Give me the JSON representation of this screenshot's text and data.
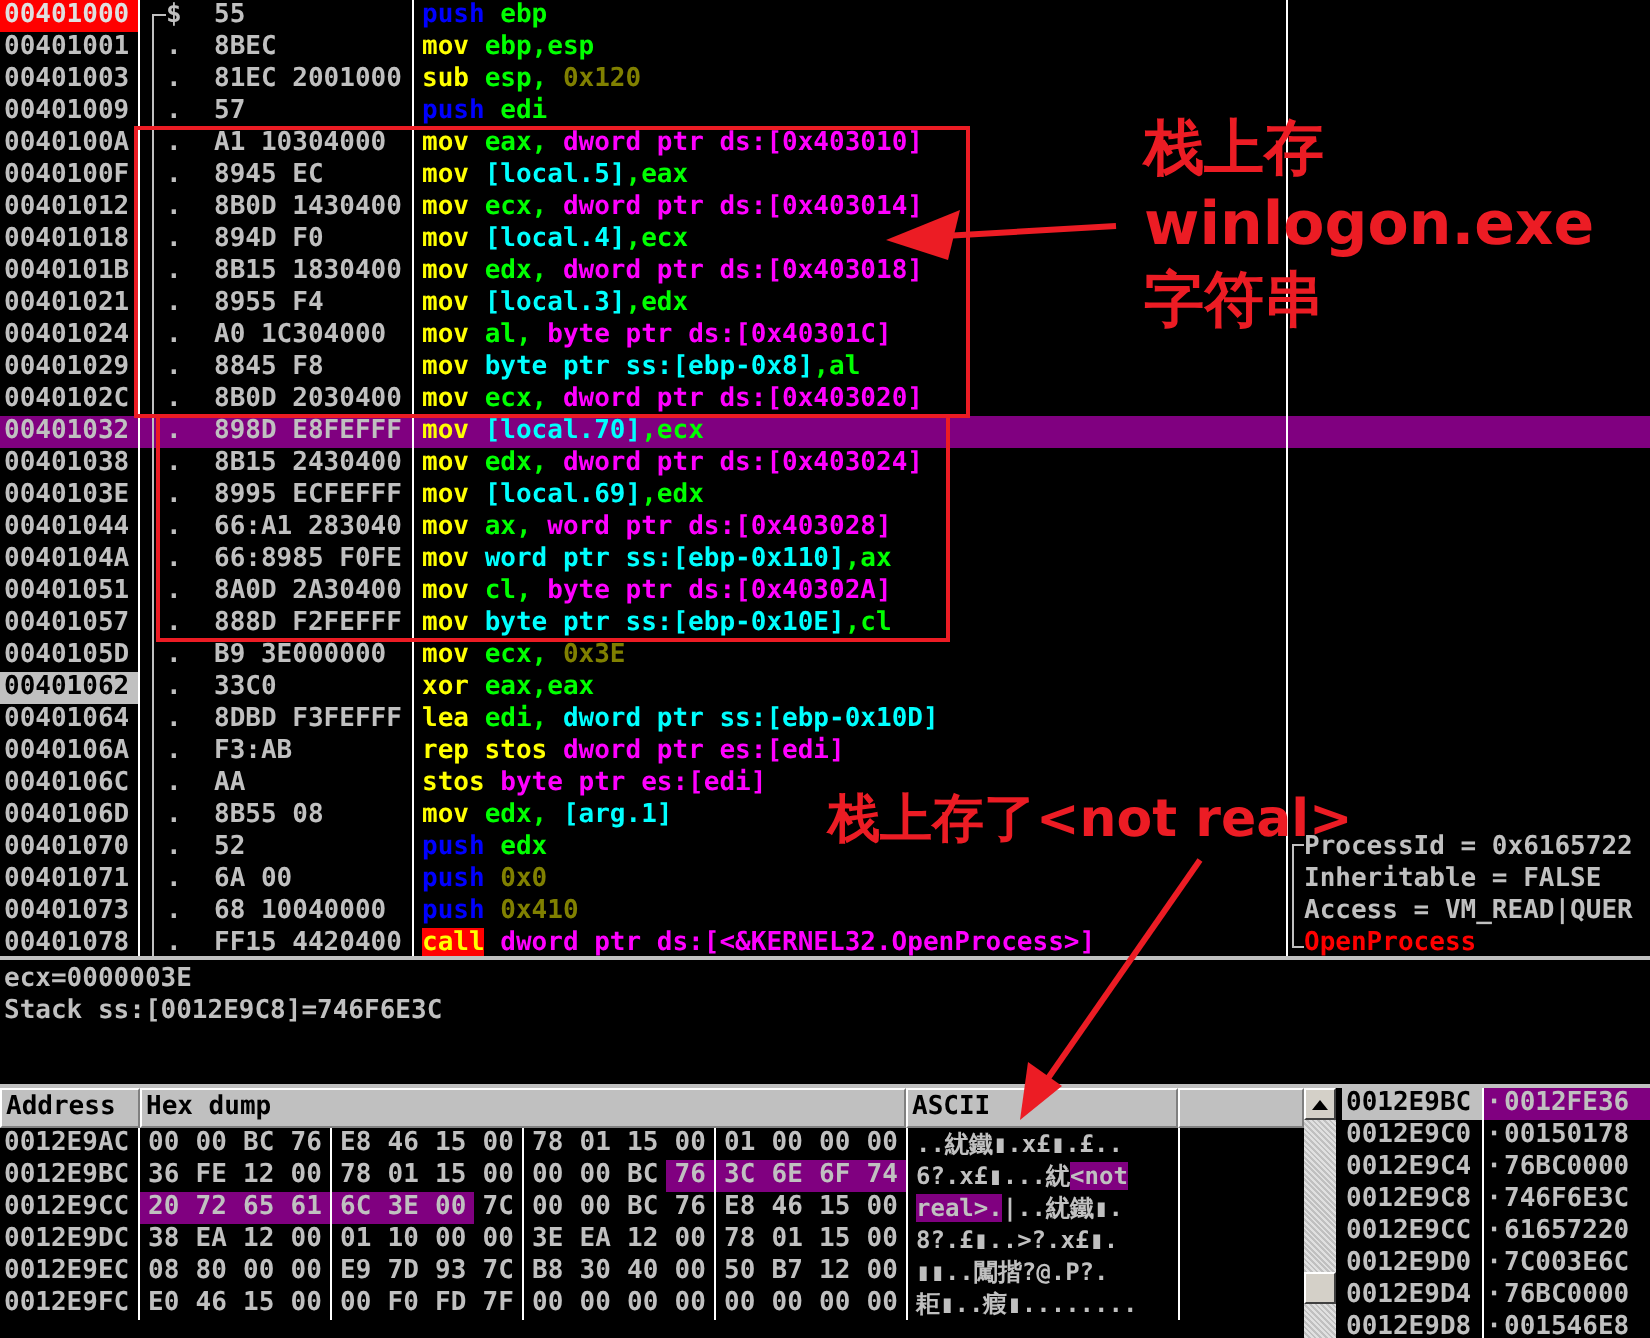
{
  "disassembly": {
    "rows": [
      {
        "address": "00401000",
        "breakpoint": true,
        "marked": false,
        "marker": "$",
        "bytes": "55",
        "selected": false,
        "instruction": [
          {
            "text": "push",
            "kind": "push"
          },
          {
            "text": "ebp",
            "kind": "reg"
          }
        ]
      },
      {
        "address": "00401001",
        "breakpoint": false,
        "marked": false,
        "marker": ".",
        "bytes": "8BEC",
        "selected": false,
        "instruction": [
          {
            "text": "mov",
            "kind": "op"
          },
          {
            "text": "ebp,esp",
            "kind": "reg"
          }
        ]
      },
      {
        "address": "00401003",
        "breakpoint": false,
        "marked": false,
        "marker": ".",
        "bytes": "81EC 2001000",
        "selected": false,
        "instruction": [
          {
            "text": "sub",
            "kind": "op"
          },
          {
            "text": "esp,",
            "kind": "reg"
          },
          {
            "text": "0x120",
            "kind": "num"
          }
        ]
      },
      {
        "address": "00401009",
        "breakpoint": false,
        "marked": false,
        "marker": ".",
        "bytes": "57",
        "selected": false,
        "instruction": [
          {
            "text": "push",
            "kind": "push"
          },
          {
            "text": "edi",
            "kind": "reg"
          }
        ]
      },
      {
        "address": "0040100A",
        "breakpoint": false,
        "marked": false,
        "marker": ".",
        "bytes": "A1 10304000",
        "selected": false,
        "instruction": [
          {
            "text": "mov",
            "kind": "op"
          },
          {
            "text": "eax,",
            "kind": "reg"
          },
          {
            "text": "dword ptr ds:[0x403010]",
            "kind": "mem"
          }
        ]
      },
      {
        "address": "0040100F",
        "breakpoint": false,
        "marked": false,
        "marker": ".",
        "bytes": "8945 EC",
        "selected": false,
        "instruction": [
          {
            "text": "mov",
            "kind": "op"
          },
          {
            "text": "[local.5]",
            "kind": "stack"
          },
          {
            "text": ",eax",
            "kind": "reg"
          }
        ]
      },
      {
        "address": "00401012",
        "breakpoint": false,
        "marked": false,
        "marker": ".",
        "bytes": "8B0D 1430400",
        "selected": false,
        "instruction": [
          {
            "text": "mov",
            "kind": "op"
          },
          {
            "text": "ecx,",
            "kind": "reg"
          },
          {
            "text": "dword ptr ds:[0x403014]",
            "kind": "mem"
          }
        ]
      },
      {
        "address": "00401018",
        "breakpoint": false,
        "marked": false,
        "marker": ".",
        "bytes": "894D F0",
        "selected": false,
        "instruction": [
          {
            "text": "mov",
            "kind": "op"
          },
          {
            "text": "[local.4]",
            "kind": "stack"
          },
          {
            "text": ",ecx",
            "kind": "reg"
          }
        ]
      },
      {
        "address": "0040101B",
        "breakpoint": false,
        "marked": false,
        "marker": ".",
        "bytes": "8B15 1830400",
        "selected": false,
        "instruction": [
          {
            "text": "mov",
            "kind": "op"
          },
          {
            "text": "edx,",
            "kind": "reg"
          },
          {
            "text": "dword ptr ds:[0x403018]",
            "kind": "mem"
          }
        ]
      },
      {
        "address": "00401021",
        "breakpoint": false,
        "marked": false,
        "marker": ".",
        "bytes": "8955 F4",
        "selected": false,
        "instruction": [
          {
            "text": "mov",
            "kind": "op"
          },
          {
            "text": "[local.3]",
            "kind": "stack"
          },
          {
            "text": ",edx",
            "kind": "reg"
          }
        ]
      },
      {
        "address": "00401024",
        "breakpoint": false,
        "marked": false,
        "marker": ".",
        "bytes": "A0 1C304000",
        "selected": false,
        "instruction": [
          {
            "text": "mov",
            "kind": "op"
          },
          {
            "text": "al,",
            "kind": "reg"
          },
          {
            "text": "byte ptr ds:[0x40301C]",
            "kind": "mem"
          }
        ]
      },
      {
        "address": "00401029",
        "breakpoint": false,
        "marked": false,
        "marker": ".",
        "bytes": "8845 F8",
        "selected": false,
        "instruction": [
          {
            "text": "mov",
            "kind": "op"
          },
          {
            "text": "byte ptr ss:[ebp-0x8]",
            "kind": "stack"
          },
          {
            "text": ",al",
            "kind": "reg"
          }
        ]
      },
      {
        "address": "0040102C",
        "breakpoint": false,
        "marked": false,
        "marker": ".",
        "bytes": "8B0D 2030400",
        "selected": false,
        "instruction": [
          {
            "text": "mov",
            "kind": "op"
          },
          {
            "text": "ecx,",
            "kind": "reg"
          },
          {
            "text": "dword ptr ds:[0x403020]",
            "kind": "mem"
          }
        ]
      },
      {
        "address": "00401032",
        "breakpoint": false,
        "marked": false,
        "marker": ".",
        "bytes": "898D E8FEFFF",
        "selected": true,
        "instruction": [
          {
            "text": "mov",
            "kind": "op"
          },
          {
            "text": "[local.70]",
            "kind": "stack"
          },
          {
            "text": ",ecx",
            "kind": "reg"
          }
        ]
      },
      {
        "address": "00401038",
        "breakpoint": false,
        "marked": false,
        "marker": ".",
        "bytes": "8B15 2430400",
        "selected": false,
        "instruction": [
          {
            "text": "mov",
            "kind": "op"
          },
          {
            "text": "edx,",
            "kind": "reg"
          },
          {
            "text": "dword ptr ds:[0x403024]",
            "kind": "mem"
          }
        ]
      },
      {
        "address": "0040103E",
        "breakpoint": false,
        "marked": false,
        "marker": ".",
        "bytes": "8995 ECFEFFF",
        "selected": false,
        "instruction": [
          {
            "text": "mov",
            "kind": "op"
          },
          {
            "text": "[local.69]",
            "kind": "stack"
          },
          {
            "text": ",edx",
            "kind": "reg"
          }
        ]
      },
      {
        "address": "00401044",
        "breakpoint": false,
        "marked": false,
        "marker": ".",
        "bytes": "66:A1 283040",
        "selected": false,
        "instruction": [
          {
            "text": "mov",
            "kind": "op"
          },
          {
            "text": "ax,",
            "kind": "reg"
          },
          {
            "text": "word ptr ds:[0x403028]",
            "kind": "mem"
          }
        ]
      },
      {
        "address": "0040104A",
        "breakpoint": false,
        "marked": false,
        "marker": ".",
        "bytes": "66:8985 F0FE",
        "selected": false,
        "instruction": [
          {
            "text": "mov",
            "kind": "op"
          },
          {
            "text": "word ptr ss:[ebp-0x110]",
            "kind": "stack"
          },
          {
            "text": ",ax",
            "kind": "reg"
          }
        ]
      },
      {
        "address": "00401051",
        "breakpoint": false,
        "marked": false,
        "marker": ".",
        "bytes": "8A0D 2A30400",
        "selected": false,
        "instruction": [
          {
            "text": "mov",
            "kind": "op"
          },
          {
            "text": "cl,",
            "kind": "reg"
          },
          {
            "text": "byte ptr ds:[0x40302A]",
            "kind": "mem"
          }
        ]
      },
      {
        "address": "00401057",
        "breakpoint": false,
        "marked": false,
        "marker": ".",
        "bytes": "888D F2FEFFF",
        "selected": false,
        "instruction": [
          {
            "text": "mov",
            "kind": "op"
          },
          {
            "text": "byte ptr ss:[ebp-0x10E]",
            "kind": "stack"
          },
          {
            "text": ",cl",
            "kind": "reg"
          }
        ]
      },
      {
        "address": "0040105D",
        "breakpoint": false,
        "marked": false,
        "marker": ".",
        "bytes": "B9 3E000000",
        "selected": false,
        "instruction": [
          {
            "text": "mov",
            "kind": "op"
          },
          {
            "text": "ecx,",
            "kind": "reg"
          },
          {
            "text": "0x3E",
            "kind": "num"
          }
        ]
      },
      {
        "address": "00401062",
        "breakpoint": false,
        "marked": true,
        "marker": ".",
        "bytes": "33C0",
        "selected": false,
        "instruction": [
          {
            "text": "xor",
            "kind": "op"
          },
          {
            "text": "eax,eax",
            "kind": "reg"
          }
        ]
      },
      {
        "address": "00401064",
        "breakpoint": false,
        "marked": false,
        "marker": ".",
        "bytes": "8DBD F3FEFFF",
        "selected": false,
        "instruction": [
          {
            "text": "lea",
            "kind": "op"
          },
          {
            "text": "edi,",
            "kind": "reg"
          },
          {
            "text": "dword ptr ss:[ebp-0x10D]",
            "kind": "stack"
          }
        ]
      },
      {
        "address": "0040106A",
        "breakpoint": false,
        "marked": false,
        "marker": ".",
        "bytes": "F3:AB",
        "selected": false,
        "instruction": [
          {
            "text": "rep stos",
            "kind": "op"
          },
          {
            "text": "dword ptr es:[edi]",
            "kind": "mem"
          }
        ]
      },
      {
        "address": "0040106C",
        "breakpoint": false,
        "marked": false,
        "marker": ".",
        "bytes": "AA",
        "selected": false,
        "instruction": [
          {
            "text": "stos",
            "kind": "op"
          },
          {
            "text": "byte ptr es:[edi]",
            "kind": "mem"
          }
        ]
      },
      {
        "address": "0040106D",
        "breakpoint": false,
        "marked": false,
        "marker": ".",
        "bytes": "8B55 08",
        "selected": false,
        "instruction": [
          {
            "text": "mov",
            "kind": "op"
          },
          {
            "text": "edx,",
            "kind": "reg"
          },
          {
            "text": "[arg.1]",
            "kind": "stack"
          }
        ]
      },
      {
        "address": "00401070",
        "breakpoint": false,
        "marked": false,
        "marker": ".",
        "bytes": "52",
        "selected": false,
        "instruction": [
          {
            "text": "push",
            "kind": "push"
          },
          {
            "text": "edx",
            "kind": "reg"
          }
        ],
        "comment": {
          "text": "ProcessId = 0x6165722",
          "kind": "arg"
        }
      },
      {
        "address": "00401071",
        "breakpoint": false,
        "marked": false,
        "marker": ".",
        "bytes": "6A 00",
        "selected": false,
        "instruction": [
          {
            "text": "push",
            "kind": "push"
          },
          {
            "text": "0x0",
            "kind": "num"
          }
        ],
        "comment": {
          "text": "Inheritable = FALSE",
          "kind": "arg"
        }
      },
      {
        "address": "00401073",
        "breakpoint": false,
        "marked": false,
        "marker": ".",
        "bytes": "68 10040000",
        "selected": false,
        "instruction": [
          {
            "text": "push",
            "kind": "push"
          },
          {
            "text": "0x410",
            "kind": "num"
          }
        ],
        "comment": {
          "text": "Access = VM_READ|QUER",
          "kind": "arg"
        }
      },
      {
        "address": "00401078",
        "breakpoint": false,
        "marked": false,
        "marker": ".",
        "bytes": "FF15 4420400",
        "selected": false,
        "instruction": [
          {
            "text": "call",
            "kind": "call"
          },
          {
            "text": "dword ptr ds:[<&KERNEL32.OpenProcess>]",
            "kind": "mem"
          }
        ],
        "comment": {
          "text": "OpenProcess",
          "kind": "api"
        }
      }
    ]
  },
  "info": [
    "ecx=0000003E",
    "Stack ss:[0012E9C8]=746F6E3C"
  ],
  "dump": {
    "columns": [
      "Address",
      "Hex dump",
      "ASCII"
    ],
    "rows": [
      {
        "address": "0012E9AC",
        "bytes": [
          {
            "v": "00",
            "selected": false
          },
          {
            "v": "00",
            "selected": false
          },
          {
            "v": "BC",
            "selected": false
          },
          {
            "v": "76",
            "selected": false
          },
          {
            "v": "E8",
            "selected": false
          },
          {
            "v": "46",
            "selected": false
          },
          {
            "v": "15",
            "selected": false
          },
          {
            "v": "00",
            "selected": false
          },
          {
            "v": "78",
            "selected": false
          },
          {
            "v": "01",
            "selected": false
          },
          {
            "v": "15",
            "selected": false
          },
          {
            "v": "00",
            "selected": false
          },
          {
            "v": "01",
            "selected": false
          },
          {
            "v": "00",
            "selected": false
          },
          {
            "v": "00",
            "selected": false
          },
          {
            "v": "00",
            "selected": false
          }
        ],
        "ascii": [
          {
            "text": "..紌鐵▮.x£▮.£..",
            "selected": false
          }
        ]
      },
      {
        "address": "0012E9BC",
        "bytes": [
          {
            "v": "36",
            "selected": false
          },
          {
            "v": "FE",
            "selected": false
          },
          {
            "v": "12",
            "selected": false
          },
          {
            "v": "00",
            "selected": false
          },
          {
            "v": "78",
            "selected": false
          },
          {
            "v": "01",
            "selected": false
          },
          {
            "v": "15",
            "selected": false
          },
          {
            "v": "00",
            "selected": false
          },
          {
            "v": "00",
            "selected": false
          },
          {
            "v": "00",
            "selected": false
          },
          {
            "v": "BC",
            "selected": false
          },
          {
            "v": "76",
            "selected": true
          },
          {
            "v": "3C",
            "selected": true
          },
          {
            "v": "6E",
            "selected": true
          },
          {
            "v": "6F",
            "selected": true
          },
          {
            "v": "74",
            "selected": true
          }
        ],
        "ascii": [
          {
            "text": "6?.x£▮...紌",
            "selected": false
          },
          {
            "text": "<not",
            "selected": true
          }
        ]
      },
      {
        "address": "0012E9CC",
        "bytes": [
          {
            "v": "20",
            "selected": true
          },
          {
            "v": "72",
            "selected": true
          },
          {
            "v": "65",
            "selected": true
          },
          {
            "v": "61",
            "selected": true
          },
          {
            "v": "6C",
            "selected": true
          },
          {
            "v": "3E",
            "selected": true
          },
          {
            "v": "00",
            "selected": true
          },
          {
            "v": "7C",
            "selected": false
          },
          {
            "v": "00",
            "selected": false
          },
          {
            "v": "00",
            "selected": false
          },
          {
            "v": "BC",
            "selected": false
          },
          {
            "v": "76",
            "selected": false
          },
          {
            "v": "E8",
            "selected": false
          },
          {
            "v": "46",
            "selected": false
          },
          {
            "v": "15",
            "selected": false
          },
          {
            "v": "00",
            "selected": false
          }
        ],
        "ascii": [
          {
            "text": " real>.",
            "selected": true
          },
          {
            "text": "|..紌鐵▮.",
            "selected": false
          }
        ]
      },
      {
        "address": "0012E9DC",
        "bytes": [
          {
            "v": "38",
            "selected": false
          },
          {
            "v": "EA",
            "selected": false
          },
          {
            "v": "12",
            "selected": false
          },
          {
            "v": "00",
            "selected": false
          },
          {
            "v": "01",
            "selected": false
          },
          {
            "v": "10",
            "selected": false
          },
          {
            "v": "00",
            "selected": false
          },
          {
            "v": "00",
            "selected": false
          },
          {
            "v": "3E",
            "selected": false
          },
          {
            "v": "EA",
            "selected": false
          },
          {
            "v": "12",
            "selected": false
          },
          {
            "v": "00",
            "selected": false
          },
          {
            "v": "78",
            "selected": false
          },
          {
            "v": "01",
            "selected": false
          },
          {
            "v": "15",
            "selected": false
          },
          {
            "v": "00",
            "selected": false
          }
        ],
        "ascii": [
          {
            "text": "8?.£▮..>?.x£▮.",
            "selected": false
          }
        ]
      },
      {
        "address": "0012E9EC",
        "bytes": [
          {
            "v": "08",
            "selected": false
          },
          {
            "v": "80",
            "selected": false
          },
          {
            "v": "00",
            "selected": false
          },
          {
            "v": "00",
            "selected": false
          },
          {
            "v": "E9",
            "selected": false
          },
          {
            "v": "7D",
            "selected": false
          },
          {
            "v": "93",
            "selected": false
          },
          {
            "v": "7C",
            "selected": false
          },
          {
            "v": "B8",
            "selected": false
          },
          {
            "v": "30",
            "selected": false
          },
          {
            "v": "40",
            "selected": false
          },
          {
            "v": "00",
            "selected": false
          },
          {
            "v": "50",
            "selected": false
          },
          {
            "v": "B7",
            "selected": false
          },
          {
            "v": "12",
            "selected": false
          },
          {
            "v": "00",
            "selected": false
          }
        ],
        "ascii": [
          {
            "text": "▮▮..闖揩?@.P?.",
            "selected": false
          }
        ]
      },
      {
        "address": "0012E9FC",
        "bytes": [
          {
            "v": "E0",
            "selected": false
          },
          {
            "v": "46",
            "selected": false
          },
          {
            "v": "15",
            "selected": false
          },
          {
            "v": "00",
            "selected": false
          },
          {
            "v": "00",
            "selected": false
          },
          {
            "v": "F0",
            "selected": false
          },
          {
            "v": "FD",
            "selected": false
          },
          {
            "v": "7F",
            "selected": false
          },
          {
            "v": "00",
            "selected": false
          },
          {
            "v": "00",
            "selected": false
          },
          {
            "v": "00",
            "selected": false
          },
          {
            "v": "00",
            "selected": false
          },
          {
            "v": "00",
            "selected": false
          },
          {
            "v": "00",
            "selected": false
          },
          {
            "v": "00",
            "selected": false
          },
          {
            "v": "00",
            "selected": false
          }
        ],
        "ascii": [
          {
            "text": "耟▮..瘕▮........",
            "selected": false
          }
        ]
      }
    ]
  },
  "stack": {
    "rows": [
      {
        "address": "0012E9BC",
        "marker": "·",
        "value": "0012FE36",
        "selected": true
      },
      {
        "address": "0012E9C0",
        "marker": "·",
        "value": "00150178",
        "selected": false
      },
      {
        "address": "0012E9C4",
        "marker": "·",
        "value": "76BC0000",
        "selected": false
      },
      {
        "address": "0012E9C8",
        "marker": "·",
        "value": "746F6E3C",
        "selected": false
      },
      {
        "address": "0012E9CC",
        "marker": "·",
        "value": "61657220",
        "selected": false
      },
      {
        "address": "0012E9D0",
        "marker": "·",
        "value": "7C003E6C",
        "selected": false
      },
      {
        "address": "0012E9D4",
        "marker": "·",
        "value": "76BC0000",
        "selected": false
      },
      {
        "address": "0012E9D8",
        "marker": "·",
        "value": "001546E8",
        "selected": false
      }
    ]
  },
  "annotations": [
    {
      "lines": [
        "栈上存",
        "winlogon.exe",
        "字符串"
      ]
    },
    {
      "lines": [
        "栈上存了<not real>"
      ]
    }
  ]
}
